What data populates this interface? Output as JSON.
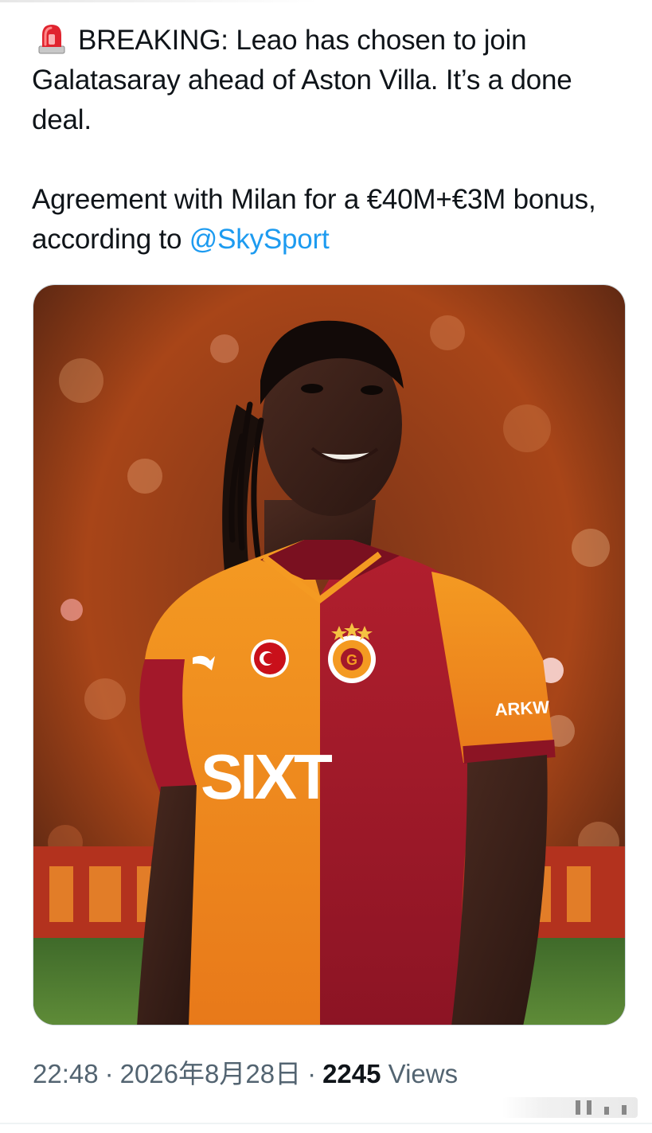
{
  "tweet": {
    "line1": "BREAKING: Leao has chosen to join Galatasaray ahead of Aston Villa. It’s a done deal.",
    "line2_prefix": "Agreement with Milan for a €40M+€3M bonus, according to ",
    "mention": "@SkySport",
    "emoji_icon": "rotating-light-siren"
  },
  "media": {
    "jersey_sponsor": "SIXT",
    "sleeve_sponsor": "ARKW",
    "colors": {
      "jersey_red": "#a3182a",
      "jersey_orange": "#f4901e",
      "background_orange": "#c3541b"
    }
  },
  "meta": {
    "time": "22:48",
    "separator": "·",
    "date": "2026年8月28日",
    "views_count": "2245",
    "views_label": "Views"
  },
  "colors": {
    "link": "#1d9bf0",
    "secondary_text": "#536471",
    "primary_text": "#0f1419"
  }
}
